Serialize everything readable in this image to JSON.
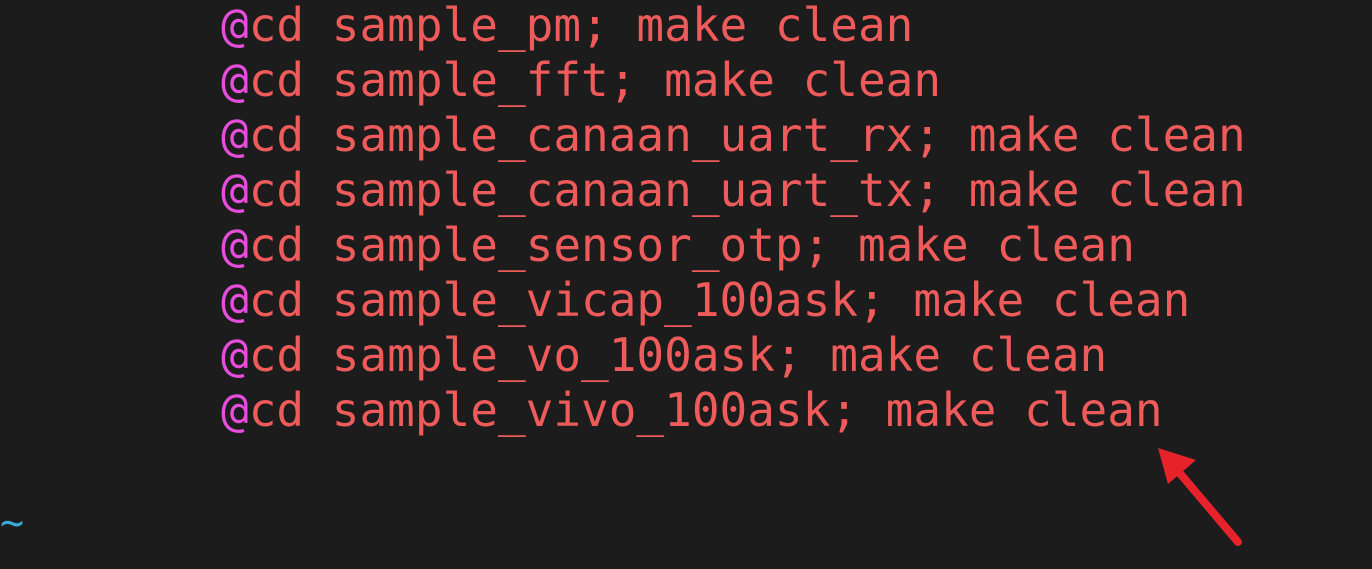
{
  "editor": {
    "lines": [
      {
        "prefix": "@",
        "text": "cd sample_pm; make clean"
      },
      {
        "prefix": "@",
        "text": "cd sample_fft; make clean"
      },
      {
        "prefix": "@",
        "text": "cd sample_canaan_uart_rx; make clean"
      },
      {
        "prefix": "@",
        "text": "cd sample_canaan_uart_tx; make clean"
      },
      {
        "prefix": "@",
        "text": "cd sample_sensor_otp; make clean"
      },
      {
        "prefix": "@",
        "text": "cd sample_vicap_100ask; make clean"
      },
      {
        "prefix": "@",
        "text": "cd sample_vo_100ask; make clean"
      },
      {
        "prefix": "@",
        "text": "cd sample_vivo_100ask; make clean"
      }
    ],
    "empty_line_marker": "~"
  },
  "annotation": {
    "arrow_color": "#e8222b"
  },
  "colors": {
    "background": "#1c1c1c",
    "at_sign": "#e64ddb",
    "command": "#ef5a5a",
    "tilde": "#3aa8d8"
  }
}
